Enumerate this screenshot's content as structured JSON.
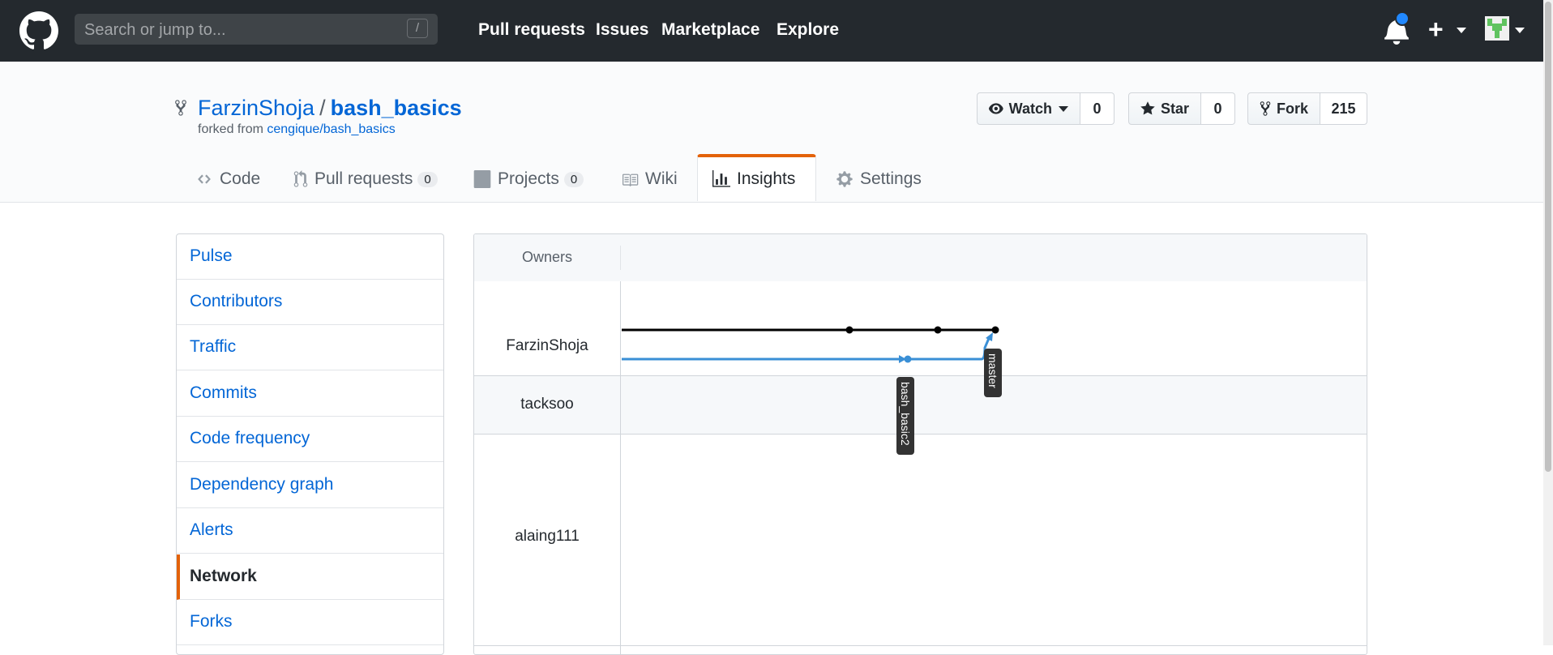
{
  "header": {
    "search_placeholder": "Search or jump to...",
    "search_shortcut": "/",
    "nav": [
      "Pull requests",
      "Issues",
      "Marketplace",
      "Explore"
    ]
  },
  "repo": {
    "owner": "FarzinShoja",
    "separator": "/",
    "name": "bash_basics",
    "forked_from_prefix": "forked from",
    "forked_from": "cengique/bash_basics",
    "watch_label": "Watch",
    "watch_count": "0",
    "star_label": "Star",
    "star_count": "0",
    "fork_label": "Fork",
    "fork_count": "215"
  },
  "tabs": {
    "code": "Code",
    "pull_requests": "Pull requests",
    "pull_requests_count": "0",
    "projects": "Projects",
    "projects_count": "0",
    "wiki": "Wiki",
    "insights": "Insights",
    "settings": "Settings"
  },
  "sidebar": {
    "items": [
      "Pulse",
      "Contributors",
      "Traffic",
      "Commits",
      "Code frequency",
      "Dependency graph",
      "Alerts",
      "Network",
      "Forks"
    ],
    "selected": "Network"
  },
  "network": {
    "owners_header": "Owners",
    "owners": [
      "FarzinShoja",
      "tacksoo",
      "alaing111"
    ],
    "branches": [
      "master",
      "bash_basic2"
    ],
    "colors": {
      "master": "#000000",
      "bash_basic2": "#3a8fd6"
    }
  },
  "colors": {
    "header_bg": "#24292e",
    "link": "#0366d6",
    "accent": "#e36209"
  }
}
